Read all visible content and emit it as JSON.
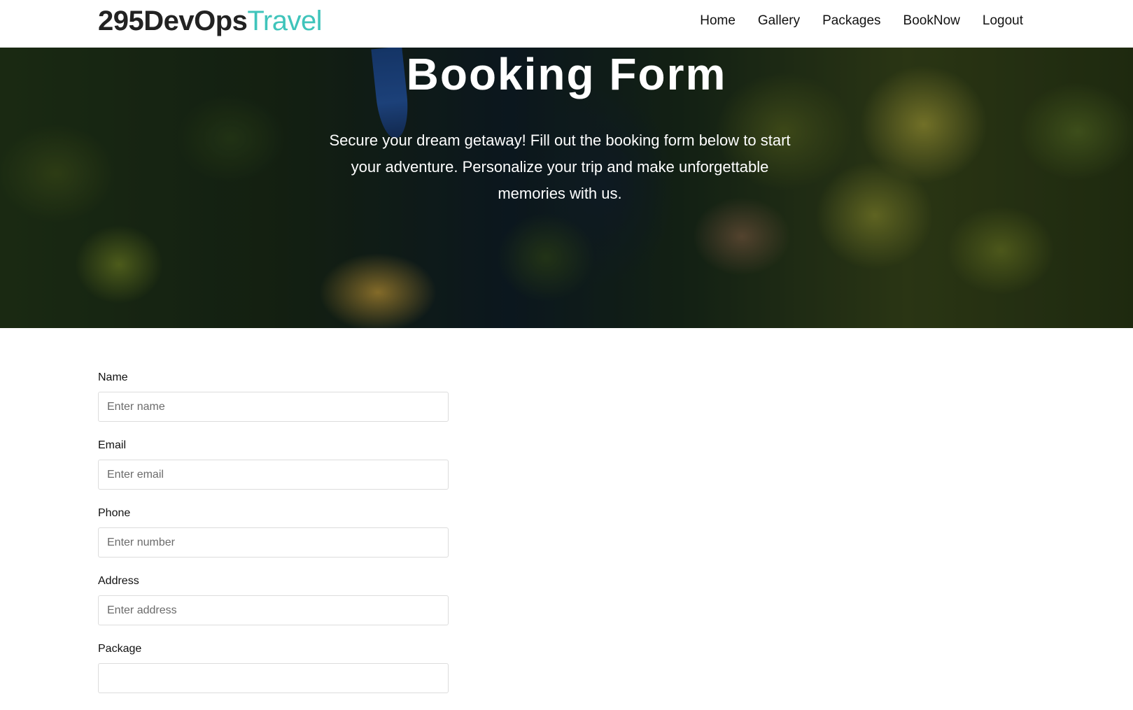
{
  "brand": {
    "main": "295DevOps",
    "accent": "Travel",
    "accent_color": "#3fc4bb"
  },
  "nav": {
    "items": [
      {
        "label": "Home"
      },
      {
        "label": "Gallery"
      },
      {
        "label": "Packages"
      },
      {
        "label": "BookNow"
      },
      {
        "label": "Logout"
      }
    ]
  },
  "hero": {
    "title": "Booking Form",
    "text": "Secure your dream getaway! Fill out the booking form below to start your adventure. Personalize your trip and make unforgettable memories with us."
  },
  "form": {
    "fields": [
      {
        "label": "Name",
        "placeholder": "Enter name",
        "value": ""
      },
      {
        "label": "Email",
        "placeholder": "Enter email",
        "value": ""
      },
      {
        "label": "Phone",
        "placeholder": "Enter number",
        "value": ""
      },
      {
        "label": "Address",
        "placeholder": "Enter address",
        "value": ""
      },
      {
        "label": "Package",
        "placeholder": "",
        "value": ""
      }
    ]
  }
}
